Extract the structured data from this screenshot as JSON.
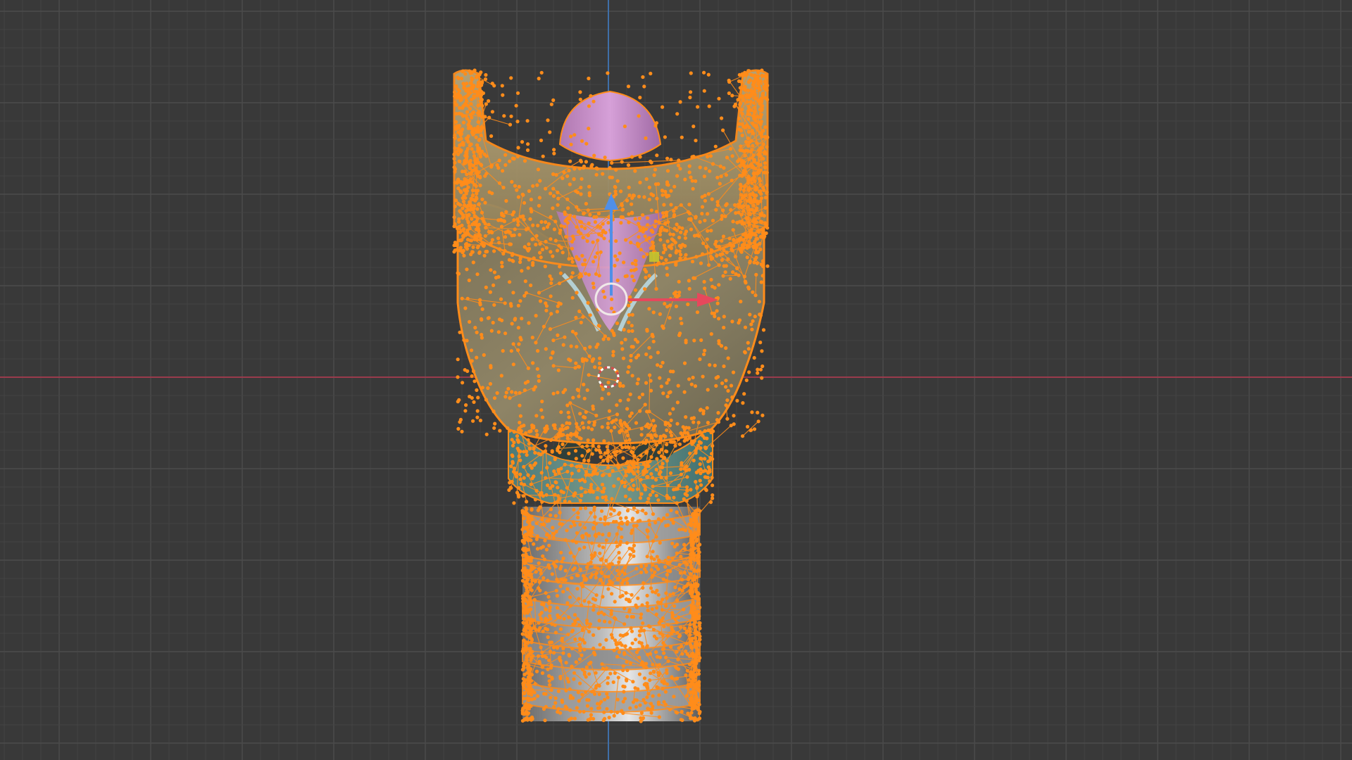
{
  "app": {
    "name": "3D Viewport",
    "mode": "edit-mode",
    "view": "front-orthographic"
  },
  "colors": {
    "background": "#393939",
    "grid_minor": "#444444",
    "grid_major": "#4c4c4c",
    "x_axis": "#9a3b4c",
    "z_axis": "#3f6fa8",
    "selection": "#ff8c1a",
    "gizmo_x": "#e6485c",
    "gizmo_z": "#4f8fe8",
    "gizmo_ring": "#f0e8e8",
    "cursor": "#d84a4a"
  },
  "scene": {
    "object": "larynx-mesh",
    "parts": [
      "thyroid-cartilage",
      "epiglottis",
      "cricoid-cartilage",
      "trachea-rings"
    ],
    "selected": true
  },
  "gizmo": {
    "type": "move",
    "axes": [
      "x",
      "z"
    ]
  }
}
